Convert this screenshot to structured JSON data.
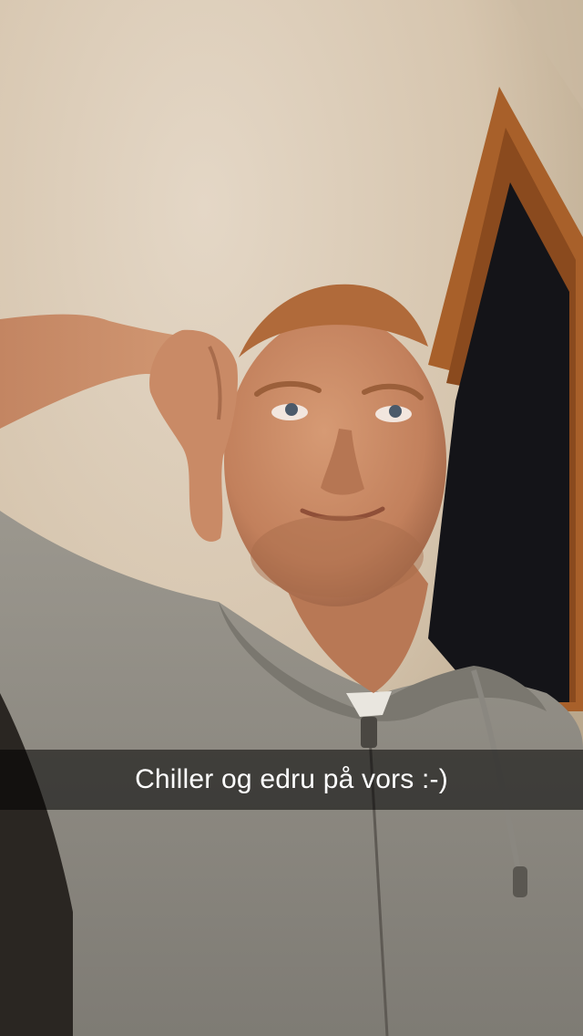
{
  "snap": {
    "caption": "Chiller og edru på vors :-)"
  },
  "colors": {
    "wall": "#d9c9b4",
    "door_frame": "#a8602a",
    "doorway_dark": "#141418",
    "hoodie": "#8f8c84",
    "skin": "#c98a66",
    "caption_bar": "rgba(0,0,0,0.55)",
    "caption_text": "#ffffff"
  }
}
